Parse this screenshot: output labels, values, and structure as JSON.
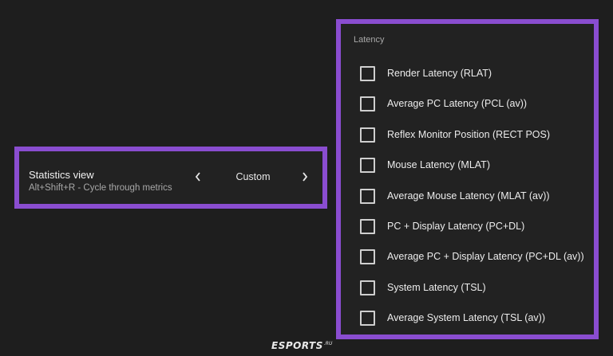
{
  "stats": {
    "title": "Statistics view",
    "subtitle": "Alt+Shift+R - Cycle through metrics",
    "value": "Custom",
    "prev_icon": "chevron-left-icon",
    "next_icon": "chevron-right-icon"
  },
  "latency": {
    "header": "Latency",
    "items": [
      {
        "label": "Render Latency (RLAT)",
        "checked": false
      },
      {
        "label": "Average PC Latency (PCL (av))",
        "checked": false
      },
      {
        "label": "Reflex Monitor Position (RECT POS)",
        "checked": false
      },
      {
        "label": "Mouse Latency (MLAT)",
        "checked": false
      },
      {
        "label": "Average Mouse Latency (MLAT (av))",
        "checked": false
      },
      {
        "label": "PC + Display Latency (PC+DL)",
        "checked": false
      },
      {
        "label": "Average PC + Display Latency (PC+DL (av))",
        "checked": false
      },
      {
        "label": "System Latency (TSL)",
        "checked": false
      },
      {
        "label": "Average System Latency (TSL (av))",
        "checked": false
      }
    ]
  },
  "watermark": {
    "text": "ESPORTS",
    "suffix": ".RU"
  },
  "colors": {
    "highlight_border": "#8a4dd0",
    "background": "#1e1e1e",
    "panel": "#222222"
  }
}
